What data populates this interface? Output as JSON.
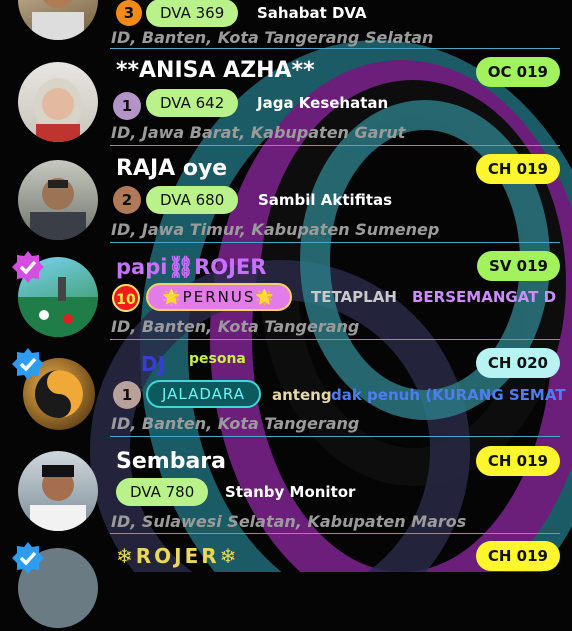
{
  "rows": [
    {
      "name": "",
      "badge": "",
      "level": "3",
      "pill": "DVA 369",
      "status": "Sahabat DVA",
      "status2": "",
      "location": "ID, Banten, Kota Tangerang Selatan"
    },
    {
      "name": "**ANISA AZHA**",
      "badge": "OC 019",
      "level": "1",
      "pill": "DVA 642",
      "status": "Jaga Kesehatan",
      "status2": "",
      "location": "ID, Jawa Barat, Kabupaten Garut"
    },
    {
      "name": "RAJA oye",
      "badge": "CH 019",
      "level": "2",
      "pill": "DVA 680",
      "status": "Sambil Aktifitas",
      "status2": "",
      "location": "ID, Jawa Timur, Kabupaten Sumenep"
    },
    {
      "name": "papi⛓ROJER",
      "badge": "SV 019",
      "level": "10",
      "pill": "🌟PERNUS🌟",
      "status": "TETAPLAH",
      "status2": "BERSEMANGAT D",
      "location": "ID, Banten, Kota Tangerang"
    },
    {
      "name": "DJ",
      "name_small": "pesona",
      "badge": "CH 020",
      "level": "1",
      "pill": "JALADARA",
      "status": "anteng",
      "status2": "dak penuh (KURANG SEMAT",
      "location": "ID, Banten, Kota Tangerang"
    },
    {
      "name": "Sembara",
      "badge": "CH 019",
      "level": "",
      "pill": "DVA 780",
      "status": "Stanby Monitor",
      "status2": "",
      "location": "ID, Sulawesi Selatan, Kabupaten Maros"
    },
    {
      "name": "❄ROJER❄",
      "badge": "CH 019",
      "level": "",
      "pill": "",
      "status": "",
      "status2": "",
      "location": ""
    }
  ],
  "colors": {
    "divider": "#4aa7c8",
    "pill_green": "#b9f28b",
    "badge_green": "#a2f25e",
    "badge_yellow": "#fdf52e",
    "badge_cyan": "#b7f3f3",
    "level_orange": "#f28a1a",
    "level_purple": "#b493c6",
    "level_red": "#ee1c1c"
  }
}
